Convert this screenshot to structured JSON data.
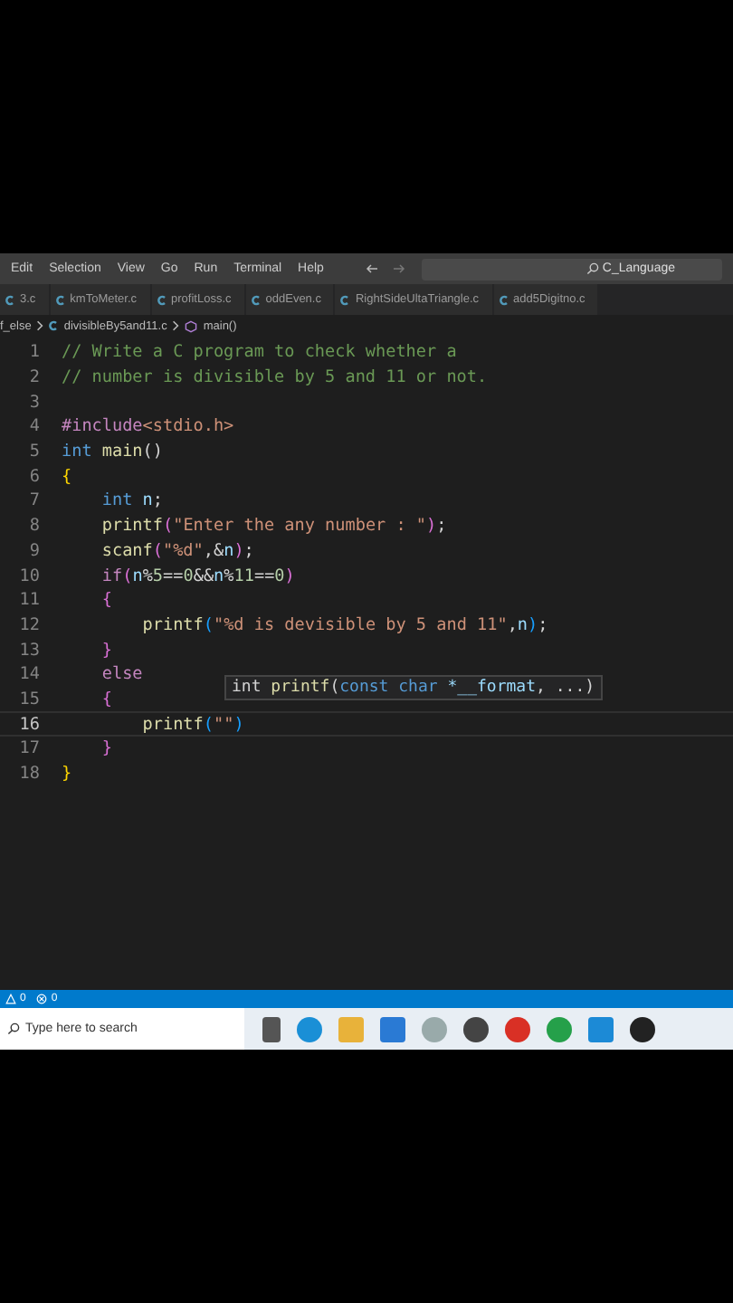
{
  "menu": [
    "Edit",
    "Selection",
    "View",
    "Go",
    "Run",
    "Terminal",
    "Help"
  ],
  "search": {
    "value": "C_Language"
  },
  "tabs": [
    {
      "label": "3.c",
      "selected": false
    },
    {
      "label": "kmToMeter.c",
      "selected": false
    },
    {
      "label": "profitLoss.c",
      "selected": false
    },
    {
      "label": "oddEven.c",
      "selected": false
    },
    {
      "label": "RightSideUltaTriangle.c",
      "selected": false
    },
    {
      "label": "add5Digitno.c",
      "selected": false
    }
  ],
  "breadcrumb": [
    {
      "kind": "folder",
      "label": "f_else"
    },
    {
      "kind": "file",
      "label": "divisibleBy5and11.c"
    },
    {
      "kind": "function",
      "label": "main()"
    }
  ],
  "code": [
    {
      "number": "1",
      "current": false,
      "tokens": [
        {
          "kind": "comment",
          "text": "// Write a C program to check whether a"
        }
      ]
    },
    {
      "number": "2",
      "current": false,
      "tokens": [
        {
          "kind": "comment",
          "text": "// number is divisible by 5 and 11 or not."
        }
      ]
    },
    {
      "number": "3",
      "current": false
    },
    {
      "number": "4",
      "current": false,
      "tokens": [
        {
          "kind": "preproc",
          "text": "#include"
        },
        {
          "kind": "string",
          "text": "<stdio.h>"
        }
      ]
    },
    {
      "number": "5",
      "current": false,
      "tokens": [
        {
          "kind": "keyword",
          "text": "int"
        },
        {
          "kind": "function",
          "text": " main"
        },
        {
          "kind": "plain",
          "text": "()"
        }
      ]
    },
    {
      "number": "6",
      "current": false,
      "tokens": [
        {
          "kind": "brace",
          "text": "{"
        }
      ]
    },
    {
      "number": "7",
      "current": false,
      "tokens": [
        {
          "kind": "keyword",
          "text": "    int"
        },
        {
          "kind": "variable",
          "text": " n"
        },
        {
          "kind": "plain",
          "text": ";"
        }
      ]
    },
    {
      "number": "8",
      "current": false,
      "tokens": [
        {
          "kind": "function",
          "text": "    printf"
        },
        {
          "kind": "brace2",
          "text": "("
        },
        {
          "kind": "string",
          "text": "\"Enter the any number : \""
        },
        {
          "kind": "brace2",
          "text": ")"
        },
        {
          "kind": "plain",
          "text": ";"
        }
      ]
    },
    {
      "number": "9",
      "current": false,
      "tokens": [
        {
          "kind": "function",
          "text": "    scanf"
        },
        {
          "kind": "brace2",
          "text": "("
        },
        {
          "kind": "string",
          "text": "\"%d\""
        },
        {
          "kind": "plain",
          "text": ",&"
        },
        {
          "kind": "variable",
          "text": "n"
        },
        {
          "kind": "brace2",
          "text": ")"
        },
        {
          "kind": "plain",
          "text": ";"
        }
      ]
    },
    {
      "number": "10",
      "current": false,
      "tokens": [
        {
          "kind": "preproc",
          "text": "    if"
        },
        {
          "kind": "brace2",
          "text": "("
        },
        {
          "kind": "variable",
          "text": "n"
        },
        {
          "kind": "plain",
          "text": "%"
        },
        {
          "kind": "number",
          "text": "5"
        },
        {
          "kind": "plain",
          "text": "=="
        },
        {
          "kind": "number",
          "text": "0"
        },
        {
          "kind": "plain",
          "text": "&&"
        },
        {
          "kind": "variable",
          "text": "n"
        },
        {
          "kind": "plain",
          "text": "%"
        },
        {
          "kind": "number",
          "text": "11"
        },
        {
          "kind": "plain",
          "text": "=="
        },
        {
          "kind": "number",
          "text": "0"
        },
        {
          "kind": "brace2",
          "text": ")"
        }
      ]
    },
    {
      "number": "11",
      "current": false,
      "tokens": [
        {
          "kind": "brace2",
          "text": "    {"
        }
      ]
    },
    {
      "number": "12",
      "current": false,
      "tokens": [
        {
          "kind": "function",
          "text": "        printf"
        },
        {
          "kind": "brace3",
          "text": "("
        },
        {
          "kind": "string",
          "text": "\"%d is devisible by 5 and 11\""
        },
        {
          "kind": "plain",
          "text": ","
        },
        {
          "kind": "variable",
          "text": "n"
        },
        {
          "kind": "brace3",
          "text": ")"
        },
        {
          "kind": "plain",
          "text": ";"
        }
      ]
    },
    {
      "number": "13",
      "current": false,
      "tokens": [
        {
          "kind": "brace2",
          "text": "    }"
        }
      ]
    },
    {
      "number": "14",
      "current": false,
      "tokens": [
        {
          "kind": "preproc",
          "text": "    else"
        }
      ]
    },
    {
      "number": "15",
      "current": false,
      "tokens": [
        {
          "kind": "brace2",
          "text": "    {"
        }
      ]
    },
    {
      "number": "16",
      "current": true,
      "tokens": [
        {
          "kind": "function",
          "text": "        printf"
        },
        {
          "kind": "brace3",
          "text": "("
        },
        {
          "kind": "string",
          "text": "\"\""
        },
        {
          "kind": "brace3",
          "text": ")"
        }
      ]
    },
    {
      "number": "17",
      "current": false,
      "tokens": [
        {
          "kind": "brace2",
          "text": "    }"
        }
      ]
    },
    {
      "number": "18",
      "current": false,
      "tokens": [
        {
          "kind": "brace",
          "text": "}"
        }
      ]
    }
  ],
  "hover": [
    {
      "kind": "plain",
      "text": "int"
    },
    {
      "kind": "function",
      "text": " printf"
    },
    {
      "kind": "plain",
      "text": "("
    },
    {
      "kind": "keyword",
      "text": "const char "
    },
    {
      "kind": "variable",
      "text": "*__format"
    },
    {
      "kind": "plain",
      "text": ", ...)"
    }
  ],
  "status": [
    {
      "kind": "warning",
      "label": "0"
    },
    {
      "kind": "error",
      "label": "0"
    }
  ],
  "taskbar": {
    "placeholder": "Type here to search"
  }
}
